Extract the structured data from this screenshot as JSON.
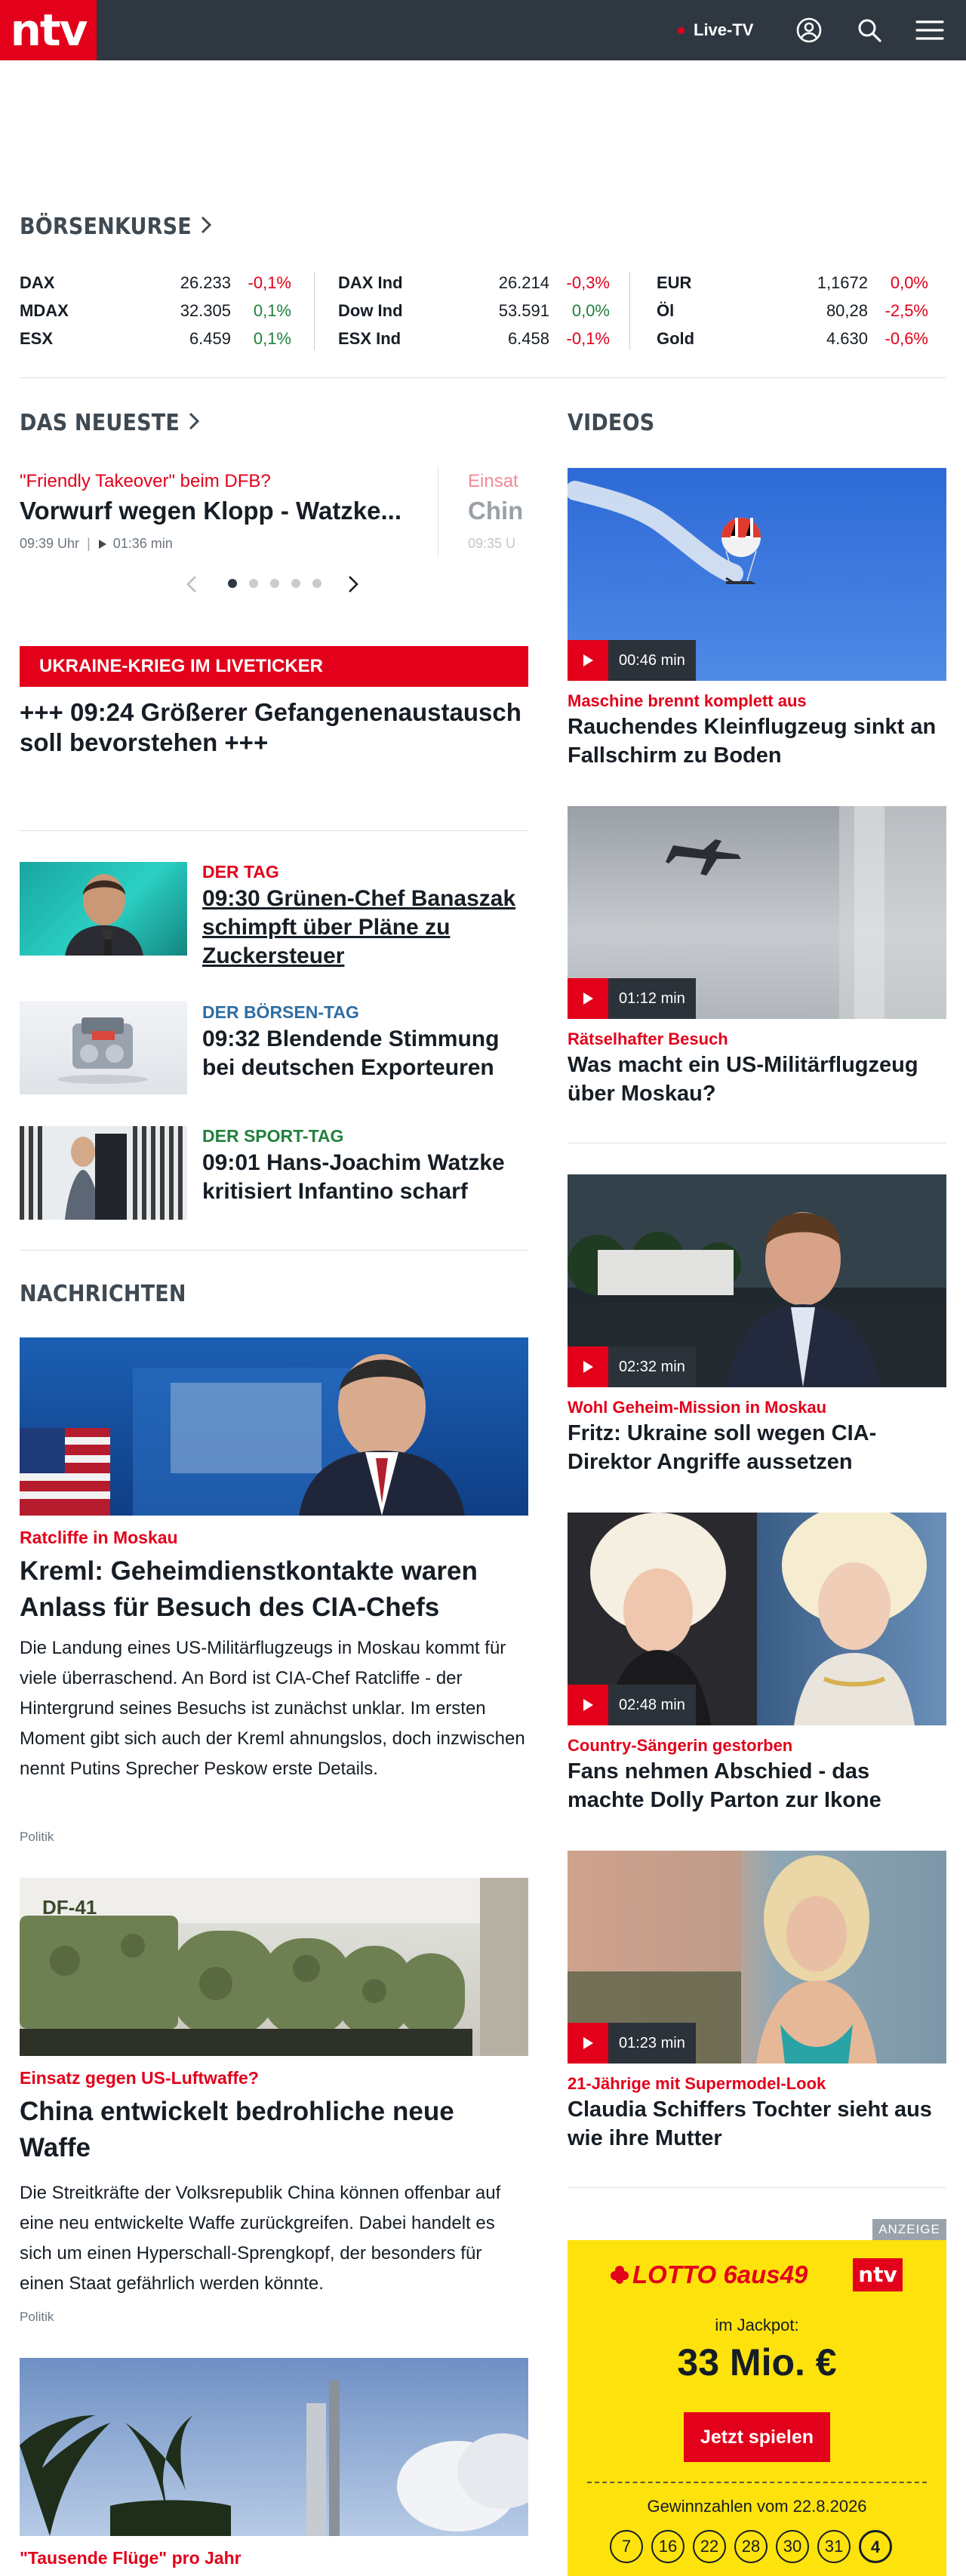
{
  "header": {
    "logo": "ntv",
    "live_label": "Live-TV",
    "icons": [
      "user-icon",
      "search-icon",
      "menu-icon"
    ]
  },
  "markets": {
    "title": "BÖRSENKURSE",
    "columns": [
      [
        {
          "name": "DAX",
          "value": "26.233",
          "change": "-0,1%"
        },
        {
          "name": "MDAX",
          "value": "32.305",
          "change": "0,1%"
        },
        {
          "name": "ESX",
          "value": "6.459",
          "change": "0,1%"
        }
      ],
      [
        {
          "name": "DAX Ind",
          "value": "26.214",
          "change": "-0,3%"
        },
        {
          "name": "Dow Ind",
          "value": "53.591",
          "change": "0,0%"
        },
        {
          "name": "ESX Ind",
          "value": "6.458",
          "change": "-0,1%"
        }
      ],
      [
        {
          "name": "EUR",
          "value": "1,1672",
          "change": "0,0%"
        },
        {
          "name": "Öl",
          "value": "80,28",
          "change": "-2,5%"
        },
        {
          "name": "Gold",
          "value": "4.630",
          "change": "-0,6%"
        }
      ]
    ]
  },
  "latest": {
    "title": "DAS NEUESTE",
    "item": {
      "kicker": "\"Friendly Takeover\" beim DFB?",
      "headline": "Vorwurf wegen Klopp - Watzke...",
      "time": "09:39 Uhr",
      "duration": "01:36 min"
    },
    "next_item": {
      "kicker": "Einsat",
      "headline": "Chin",
      "time": "09:35 U"
    }
  },
  "ticker": {
    "label": "UKRAINE-KRIEG IM LIVETICKER",
    "headline": "+++ 09:24 Größerer Gefangenenaustausch soll bevorstehen +++"
  },
  "day_items": [
    {
      "kicker": "DER TAG",
      "headline": "09:30 Grünen-Chef Banaszak schimpft über Pläne zu Zuckersteuer",
      "color": "#e2001a"
    },
    {
      "kicker": "DER BÖRSEN-TAG",
      "headline": "09:32 Blendende Stimmung bei deutschen Exporteuren",
      "color": "#2e6da4"
    },
    {
      "kicker": "DER SPORT-TAG",
      "headline": "09:01 Hans-Joachim Watzke kritisiert Infantino scharf",
      "color": "#22803c"
    }
  ],
  "news": {
    "title": "NACHRICHTEN",
    "articles": [
      {
        "kicker": "Ratcliffe in Moskau",
        "headline": "Kreml: Geheimdienstkontakte waren Anlass für Besuch des CIA-Chefs",
        "teaser": "Die Landung eines US-Militärflugzeugs in Moskau kommt für viele überraschend. An Bord ist CIA-Chef Ratcliffe - der Hintergrund seines Besuchs ist zunächst unklar. Im ersten Moment gibt sich auch der Kreml ahnungslos, doch inzwischen nennt Putins Sprecher Peskow erste Details.",
        "category": "Politik"
      },
      {
        "kicker": "Einsatz gegen US-Luftwaffe?",
        "headline": "China entwickelt bedrohliche neue Waffe",
        "teaser": "Die Streitkräfte der Volksrepublik China können offenbar auf eine neu entwickelte Waffe zurückgreifen. Dabei handelt es sich um einen Hyperschall-Sprengkopf, der besonders für einen Staat gefährlich werden könnte.",
        "category": "Politik"
      },
      {
        "kicker": "\"Tausende Flüge\" pro Jahr"
      }
    ]
  },
  "videos": {
    "title": "VIDEOS",
    "items": [
      {
        "duration": "00:46 min",
        "kicker": "Maschine brennt komplett aus",
        "headline": "Rauchendes Kleinflugzeug sinkt an Fallschirm zu Boden"
      },
      {
        "duration": "01:12 min",
        "kicker": "Rätselhafter Besuch",
        "headline": "Was macht ein US-Militärflugzeug über Moskau?"
      },
      {
        "duration": "02:32 min",
        "kicker": "Wohl Geheim-Mission in Moskau",
        "headline": "Fritz: Ukraine soll wegen CIA-Direktor Angriffe aussetzen"
      },
      {
        "duration": "02:48 min",
        "kicker": "Country-Sängerin gestorben",
        "headline": "Fans nehmen Abschied - das machte Dolly Parton zur Ikone"
      },
      {
        "duration": "01:23 min",
        "kicker": "21-Jährige mit Supermodel-Look",
        "headline": "Claudia Schiffers Tochter sieht aus wie ihre Mutter"
      }
    ]
  },
  "ad": {
    "label": "ANZEIGE",
    "lotto_logo": "LOTTO 6aus49",
    "brand": "ntv",
    "jackpot_label": "im Jackpot:",
    "jackpot": "33 Mio. €",
    "cta": "Jetzt spielen",
    "numbers_label": "Gewinnzahlen vom 22.8.2026",
    "numbers": [
      "7",
      "16",
      "22",
      "28",
      "30",
      "31",
      "4"
    ]
  }
}
